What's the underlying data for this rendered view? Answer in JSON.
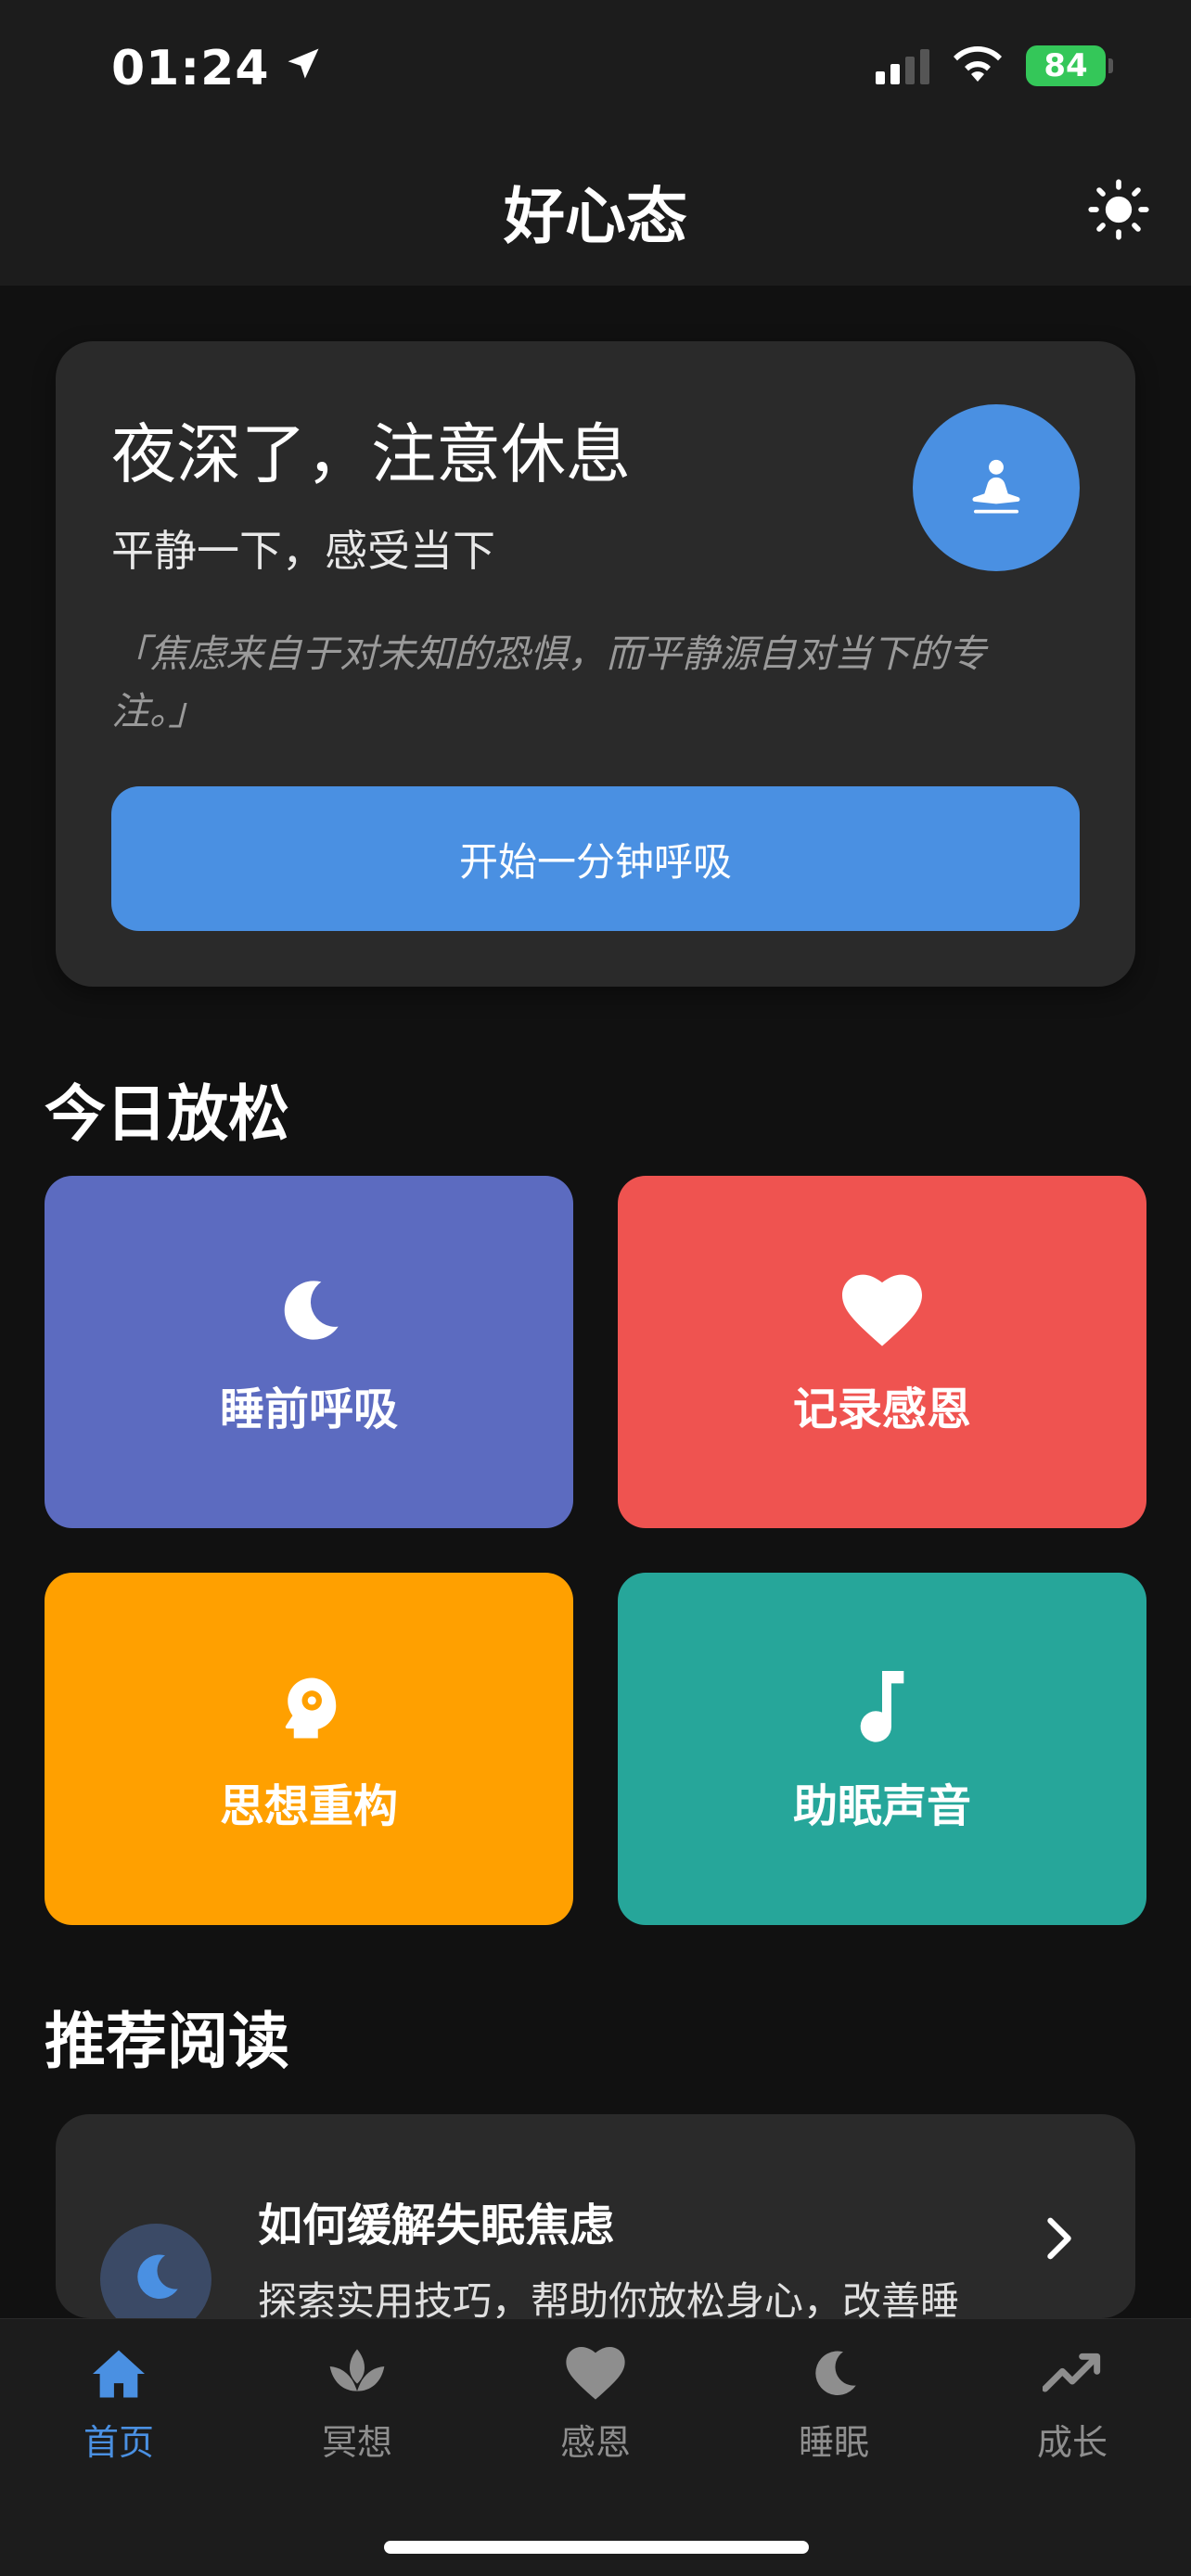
{
  "status_bar": {
    "time": "01:24",
    "battery": "84"
  },
  "header": {
    "title": "好心态"
  },
  "hero": {
    "heading": "夜深了，注意休息",
    "subheading": "平静一下，感受当下",
    "quote": "「焦虑来自于对未知的恐惧，而平静源自对当下的专注。」",
    "button_label": "开始一分钟呼吸",
    "accent": "#4a90e2"
  },
  "relax": {
    "title": "今日放松",
    "tiles": [
      {
        "label": "睡前呼吸",
        "icon": "moon-icon",
        "color": "#5c6bc0"
      },
      {
        "label": "记录感恩",
        "icon": "heart-icon",
        "color": "#ef5350"
      },
      {
        "label": "思想重构",
        "icon": "head-gear-icon",
        "color": "#ffa000"
      },
      {
        "label": "助眠声音",
        "icon": "music-note-icon",
        "color": "#26a69a"
      }
    ]
  },
  "reading": {
    "title": "推荐阅读",
    "articles": [
      {
        "title": "如何缓解失眠焦虑",
        "description": "探索实用技巧，帮助你放松身心，改善睡",
        "icon": "moon-icon"
      }
    ]
  },
  "tabs": [
    {
      "label": "首页",
      "icon": "home-icon",
      "active": true
    },
    {
      "label": "冥想",
      "icon": "lotus-icon",
      "active": false
    },
    {
      "label": "感恩",
      "icon": "heart-icon",
      "active": false
    },
    {
      "label": "睡眠",
      "icon": "moon-icon",
      "active": false
    },
    {
      "label": "成长",
      "icon": "trend-icon",
      "active": false
    }
  ],
  "colors": {
    "active_tab": "#4a90e2",
    "inactive_tab": "#8e8e8e",
    "card_bg": "#2a2a2a",
    "page_bg": "#111111"
  }
}
